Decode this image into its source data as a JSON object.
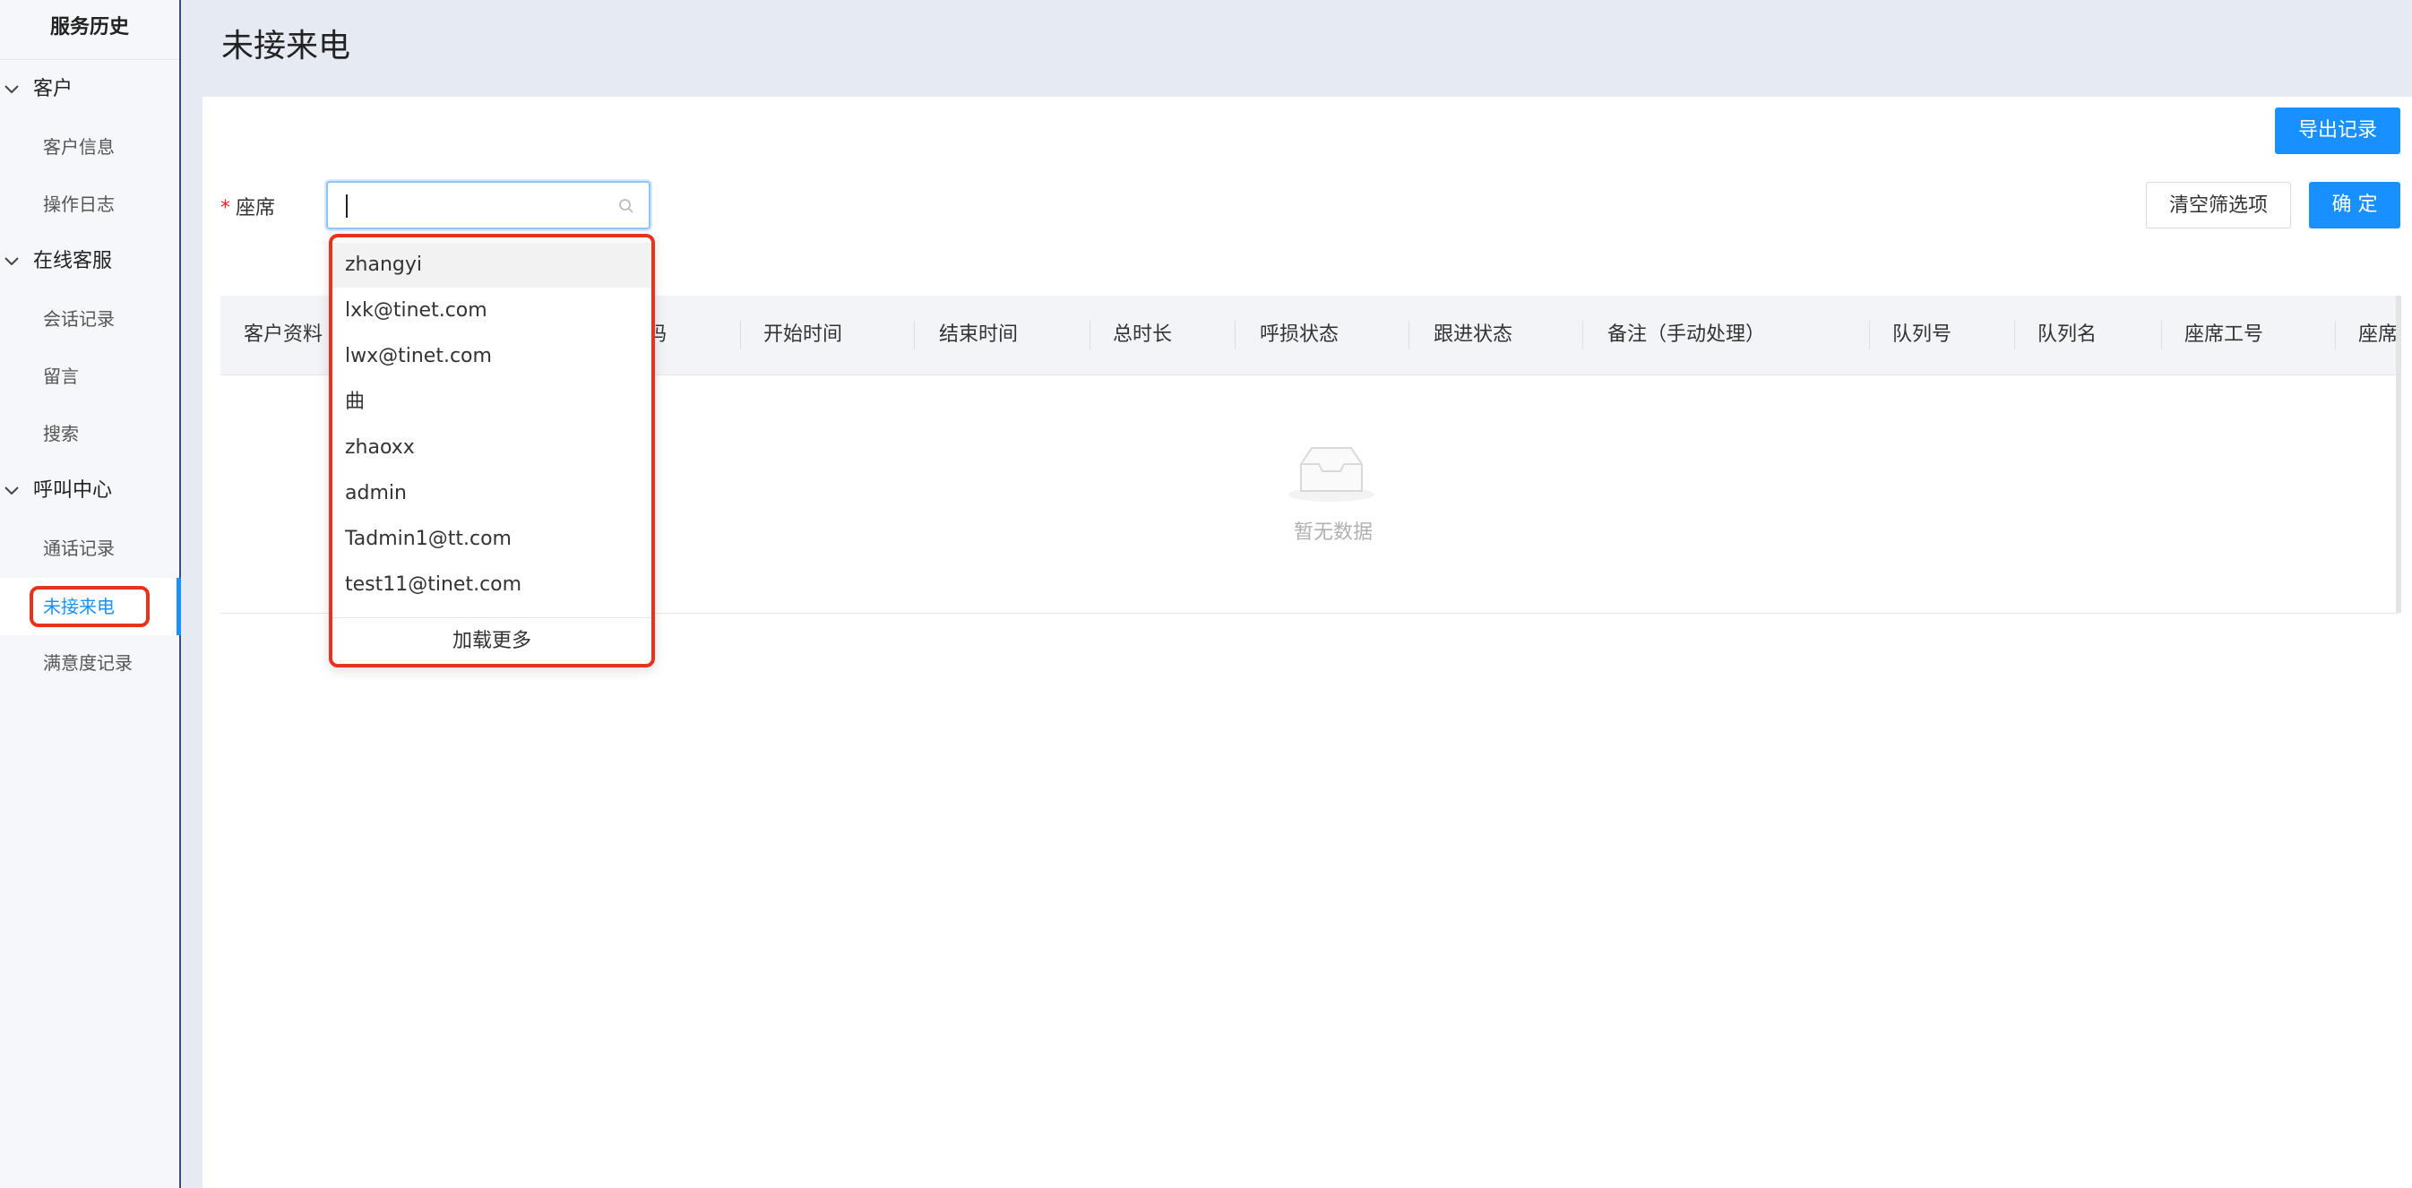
{
  "sidebar": {
    "title": "服务历史",
    "groups": [
      {
        "label": "客户",
        "items": [
          {
            "label": "客户信息"
          },
          {
            "label": "操作日志"
          }
        ]
      },
      {
        "label": "在线客服",
        "items": [
          {
            "label": "会话记录"
          },
          {
            "label": "留言"
          },
          {
            "label": "搜索"
          }
        ]
      },
      {
        "label": "呼叫中心",
        "items": [
          {
            "label": "通话记录"
          },
          {
            "label": "未接来电",
            "active": true
          },
          {
            "label": "满意度记录"
          }
        ]
      }
    ]
  },
  "page": {
    "title": "未接来电"
  },
  "toolbar": {
    "export_label": "导出记录",
    "clear_label": "清空筛选项",
    "confirm_label": "确 定"
  },
  "filter": {
    "required_mark": "*",
    "label": "座席",
    "value": ""
  },
  "dropdown": {
    "options": [
      "zhangyi",
      "lxk@tinet.com",
      "lwx@tinet.com",
      "曲",
      "zhaoxx",
      "admin",
      "Tadmin1@tt.com",
      "test11@tinet.com"
    ],
    "load_more_label": "加载更多"
  },
  "table": {
    "columns": [
      "客户资料",
      "码",
      "开始时间",
      "结束时间",
      "总时长",
      "呼损状态",
      "跟进状态",
      "备注（手动处理）",
      "队列号",
      "队列名",
      "座席工号",
      "座席"
    ],
    "empty_text": "暂无数据"
  },
  "colors": {
    "accent": "#1890ff",
    "highlight": "#e8321e",
    "sidebar_border": "#3d4a8c"
  }
}
